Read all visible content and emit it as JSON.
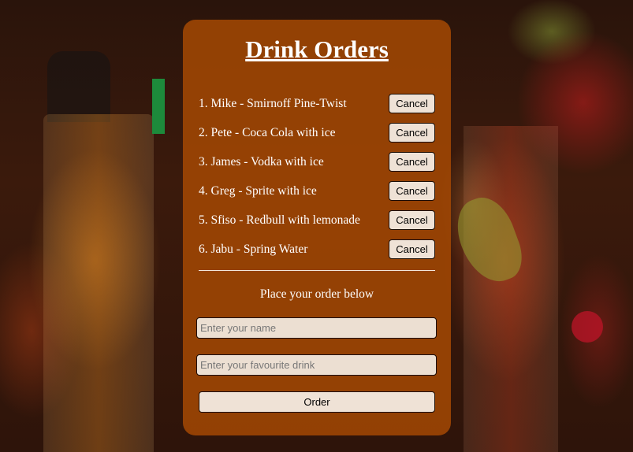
{
  "page": {
    "title": "Drink Orders",
    "subtitle": "Place your order below"
  },
  "orders": [
    {
      "text": "1. Mike - Smirnoff Pine-Twist",
      "cancel_label": "Cancel"
    },
    {
      "text": "2. Pete - Coca Cola with ice",
      "cancel_label": "Cancel"
    },
    {
      "text": "3. James - Vodka with ice",
      "cancel_label": "Cancel"
    },
    {
      "text": "4. Greg - Sprite with ice",
      "cancel_label": "Cancel"
    },
    {
      "text": "5. Sfiso - Redbull with lemonade",
      "cancel_label": "Cancel"
    },
    {
      "text": "6. Jabu - Spring Water",
      "cancel_label": "Cancel"
    }
  ],
  "form": {
    "name_placeholder": "Enter your name",
    "name_value": "",
    "drink_placeholder": "Enter your favourite drink",
    "drink_value": "",
    "order_label": "Order"
  },
  "colors": {
    "panel": "#a44804",
    "button": "#efe2d6",
    "text": "#ffffff"
  }
}
